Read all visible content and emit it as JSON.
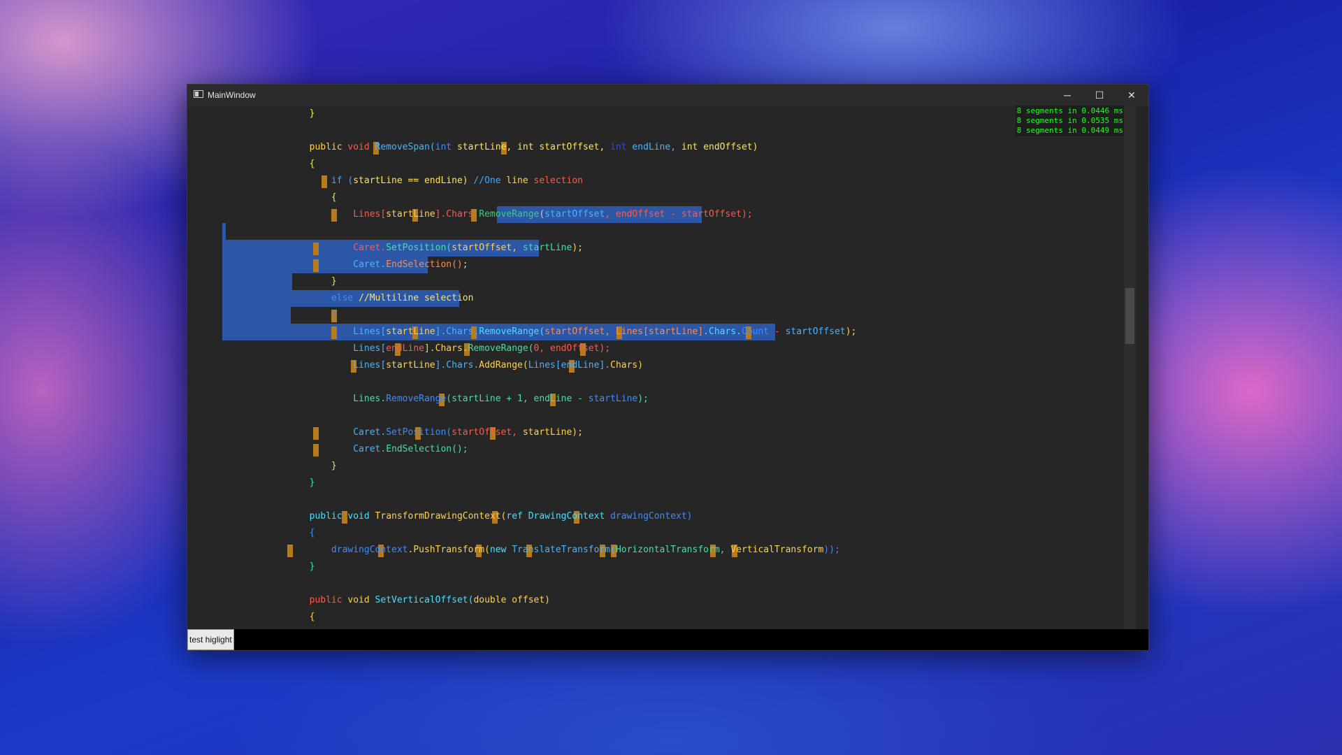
{
  "window": {
    "title": "MainWindow",
    "controls": {
      "minimize": "─",
      "maximize": "☐",
      "close": "✕"
    }
  },
  "stats": [
    "8 segments in 0.0446 ms",
    "8 segments in 0.0535 ms",
    "8 segments in 0.0449 ms"
  ],
  "code_lines": [
    [
      {
        "t": "        ",
        "c": "#cccccc"
      },
      {
        "t": "}",
        "c": "#e8e85a"
      }
    ],
    [],
    [
      {
        "t": "        public ",
        "c": "#ffd24a"
      },
      {
        "t": "void ",
        "c": "#ff5a4a"
      },
      {
        "t": "RemoveSpan(",
        "c": "#45b5ff"
      },
      {
        "t": "int ",
        "c": "#3f8cff"
      },
      {
        "t": "startLine, ",
        "c": "#ffe35a"
      },
      {
        "t": "int ",
        "c": "#ffe35a"
      },
      {
        "t": "startOffset, ",
        "c": "#ffe35a"
      },
      {
        "t": "int ",
        "c": "#2a4ee0"
      },
      {
        "t": "endLine, ",
        "c": "#45b5ff"
      },
      {
        "t": "int ",
        "c": "#ffe35a"
      },
      {
        "t": "endOffset)",
        "c": "#ffe35a"
      }
    ],
    [
      {
        "t": "        {",
        "c": "#e8e85a"
      }
    ],
    [
      {
        "t": "            if (",
        "c": "#3fa8ff"
      },
      {
        "t": "startLine == endLine) ",
        "c": "#ffe35a"
      },
      {
        "t": "//One ",
        "c": "#3fa8ff"
      },
      {
        "t": "line ",
        "c": "#ffd24a"
      },
      {
        "t": "selection",
        "c": "#ff5a4a"
      }
    ],
    [
      {
        "t": "            {",
        "c": "#e8e85a"
      }
    ],
    [
      {
        "t": "                Lines[",
        "c": "#ff5a4a"
      },
      {
        "t": "startLine",
        "c": "#ffd24a"
      },
      {
        "t": "].Chars.",
        "c": "#ff5a4a"
      },
      {
        "t": "RemoveRange",
        "c": "#35d46a"
      },
      {
        "t": "(",
        "c": "#cccccc"
      },
      {
        "t": "startOffset",
        "c": "#45b5ff"
      },
      {
        "t": ", endOffset - startOffset);",
        "c": "#ff5a4a"
      }
    ],
    [],
    [
      {
        "t": "                Caret.",
        "c": "#ff5a4a"
      },
      {
        "t": "SetPosition(",
        "c": "#45e0a0"
      },
      {
        "t": "startOffset, ",
        "c": "#ffd24a"
      },
      {
        "t": "startLine",
        "c": "#45e0a0"
      },
      {
        "t": ");",
        "c": "#ffd24a"
      }
    ],
    [
      {
        "t": "                Caret.",
        "c": "#45b5ff"
      },
      {
        "t": "EndSelection()",
        "c": "#ff8a4a"
      },
      {
        "t": ";",
        "c": "#cccccc"
      }
    ],
    [
      {
        "t": "            }",
        "c": "#e8e85a"
      }
    ],
    [
      {
        "t": "            else ",
        "c": "#3f8cff"
      },
      {
        "t": "//Multiline selection",
        "c": "#ffe35a"
      }
    ],
    [
      {
        "t": "            {",
        "c": "#3f8cff"
      }
    ],
    [
      {
        "t": "                Lines[",
        "c": "#45b5ff"
      },
      {
        "t": "startLine",
        "c": "#ffd24a"
      },
      {
        "t": "].Chars.",
        "c": "#45b5ff"
      },
      {
        "t": "RemoveRange(",
        "c": "#45e0ff"
      },
      {
        "t": "startOffset, Lines[startLine]",
        "c": "#ff8a4a"
      },
      {
        "t": ".Chars.",
        "c": "#45e0ff"
      },
      {
        "t": "Count",
        "c": "#3f8cff"
      },
      {
        "t": " - ",
        "c": "#ff5a4a"
      },
      {
        "t": "startOffset",
        "c": "#45b5ff"
      },
      {
        "t": ");",
        "c": "#ffd24a"
      }
    ],
    [
      {
        "t": "                Lines[",
        "c": "#45b5ff"
      },
      {
        "t": "endLine",
        "c": "#ff5a4a"
      },
      {
        "t": "].Chars.",
        "c": "#ffd24a"
      },
      {
        "t": "RemoveRange(",
        "c": "#45e0a0"
      },
      {
        "t": "0, ",
        "c": "#ff5a4a"
      },
      {
        "t": "endOffset);",
        "c": "#ff5a4a"
      }
    ],
    [
      {
        "t": "                Lines[",
        "c": "#45b5ff"
      },
      {
        "t": "startLine",
        "c": "#ffd24a"
      },
      {
        "t": "].Chars.",
        "c": "#45b5ff"
      },
      {
        "t": "AddRange(",
        "c": "#ffd24a"
      },
      {
        "t": "Lines[endLine].",
        "c": "#45b5ff"
      },
      {
        "t": "Chars)",
        "c": "#ffd24a"
      }
    ],
    [],
    [
      {
        "t": "                Lines.",
        "c": "#45e0a0"
      },
      {
        "t": "RemoveRange",
        "c": "#3f8cff"
      },
      {
        "t": "(startLine + 1, endLine - ",
        "c": "#45e0a0"
      },
      {
        "t": "startLine",
        "c": "#3f8cff"
      },
      {
        "t": ");",
        "c": "#45e0a0"
      }
    ],
    [],
    [
      {
        "t": "                Caret.",
        "c": "#45b5ff"
      },
      {
        "t": "SetPosition(",
        "c": "#3f8cff"
      },
      {
        "t": "startOffset, ",
        "c": "#ff5a4a"
      },
      {
        "t": "startLine);",
        "c": "#ffd24a"
      }
    ],
    [
      {
        "t": "                Caret.",
        "c": "#45b5ff"
      },
      {
        "t": "EndSelection();",
        "c": "#45e0a0"
      }
    ],
    [
      {
        "t": "            }",
        "c": "#e8e85a"
      }
    ],
    [
      {
        "t": "        }",
        "c": "#45e0a0"
      }
    ],
    [],
    [
      {
        "t": "        public void ",
        "c": "#45e0ff"
      },
      {
        "t": "TransformDrawingContext(",
        "c": "#ffd24a"
      },
      {
        "t": "ref DrawingContext ",
        "c": "#45e0ff"
      },
      {
        "t": "drawingContext)",
        "c": "#3f8cff"
      }
    ],
    [
      {
        "t": "        {",
        "c": "#3f8cff"
      }
    ],
    [
      {
        "t": "            drawingContext",
        "c": "#3f8cff"
      },
      {
        "t": ".PushTransform(",
        "c": "#ffd24a"
      },
      {
        "t": "new ",
        "c": "#45e0ff"
      },
      {
        "t": "TranslateTransform(",
        "c": "#45b5ff"
      },
      {
        "t": "HorizontalTransform, ",
        "c": "#45e0a0"
      },
      {
        "t": "VerticalTransform",
        "c": "#ffd24a"
      },
      {
        "t": "));",
        "c": "#3f8cff"
      }
    ],
    [
      {
        "t": "        }",
        "c": "#45e0a0"
      }
    ],
    [],
    [
      {
        "t": "        public ",
        "c": "#ff5a4a"
      },
      {
        "t": "void ",
        "c": "#ffd24a"
      },
      {
        "t": "SetVerticalOffset(",
        "c": "#45e0ff"
      },
      {
        "t": "double offset)",
        "c": "#ffd24a"
      }
    ],
    [
      {
        "t": "        {",
        "c": "#ffd24a"
      }
    ]
  ],
  "statusbar": {
    "button_label": "test higlight"
  }
}
